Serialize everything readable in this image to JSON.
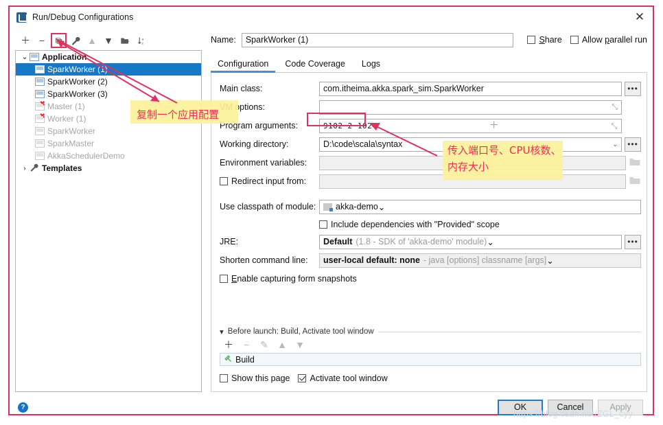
{
  "window": {
    "title": "Run/Debug Configurations",
    "close_label": "✕",
    "app_icon": "intellij-run-icon"
  },
  "left_toolbar": {
    "buttons": [
      {
        "name": "add-configuration",
        "glyph": "＋",
        "disabled": false,
        "highlighted": false
      },
      {
        "name": "remove-configuration",
        "glyph": "−",
        "disabled": false,
        "highlighted": false
      },
      {
        "name": "copy-configuration",
        "glyph": "⧉",
        "disabled": false,
        "highlighted": true
      },
      {
        "name": "edit-templates",
        "glyph": "🔧",
        "disabled": false,
        "highlighted": false
      },
      {
        "name": "move-up",
        "glyph": "▲",
        "disabled": true,
        "highlighted": false
      },
      {
        "name": "move-down",
        "glyph": "▼",
        "disabled": false,
        "highlighted": false
      },
      {
        "name": "move-into-folder",
        "glyph": "◧",
        "disabled": false,
        "highlighted": false
      },
      {
        "name": "sort-configurations",
        "glyph": "↓",
        "disabled": false,
        "highlighted": false
      }
    ]
  },
  "tree": {
    "groups": [
      {
        "label": "Application",
        "expanded": true,
        "twisty": "⌄",
        "icon": "application-folder-icon",
        "items": [
          {
            "label": "SparkWorker (1)",
            "selected": true,
            "faded": false,
            "error": false
          },
          {
            "label": "SparkWorker (2)",
            "selected": false,
            "faded": false,
            "error": false
          },
          {
            "label": "SparkWorker (3)",
            "selected": false,
            "faded": false,
            "error": false
          },
          {
            "label": "Master (1)",
            "selected": false,
            "faded": true,
            "error": true
          },
          {
            "label": "Worker (1)",
            "selected": false,
            "faded": true,
            "error": true
          },
          {
            "label": "SparkWorker",
            "selected": false,
            "faded": true,
            "error": false
          },
          {
            "label": "SparkMaster",
            "selected": false,
            "faded": true,
            "error": false
          },
          {
            "label": "AkkaSchedulerDemo",
            "selected": false,
            "faded": true,
            "error": false
          }
        ]
      },
      {
        "label": "Templates",
        "expanded": false,
        "twisty": "›",
        "icon": "wrench-icon",
        "items": []
      }
    ]
  },
  "header": {
    "name_label": "Name:",
    "name_value": "SparkWorker (1)",
    "share_label": "Share",
    "share_checked": false,
    "allow_parallel_label": "Allow parallel run",
    "allow_parallel_checked": false
  },
  "tabs": [
    {
      "label": "Configuration",
      "active": true
    },
    {
      "label": "Code Coverage",
      "active": false
    },
    {
      "label": "Logs",
      "active": false
    }
  ],
  "form": {
    "main_class": {
      "label": "Main class:",
      "value": "com.itheima.akka.spark_sim.SparkWorker",
      "browse_glyph": "•••"
    },
    "vm_options": {
      "label": "VM options:",
      "value": "",
      "expand_glyph": "⤡"
    },
    "program_arguments": {
      "label": "Program arguments:",
      "value": "9102 2 1024",
      "plus_glyph": "＋",
      "expand_glyph": "⤡"
    },
    "working_directory": {
      "label": "Working directory:",
      "value": "D:\\code\\scala\\syntax",
      "caret_glyph": "⌄",
      "browse_glyph": "•••"
    },
    "environment_variables": {
      "label": "Environment variables:",
      "value": "",
      "folder_glyph": "🗀"
    },
    "redirect_input": {
      "label": "Redirect input from:",
      "checked": false,
      "value": "",
      "folder_glyph": "🗀"
    },
    "classpath_module": {
      "label": "Use classpath of module:",
      "value": "akka-demo",
      "caret_glyph": "⌄"
    },
    "include_provided": {
      "label": "Include dependencies with \"Provided\" scope",
      "checked": false
    },
    "jre": {
      "label": "JRE:",
      "value": "Default",
      "hint": "(1.8 - SDK of 'akka-demo' module)",
      "caret_glyph": "⌄",
      "browse_glyph": "•••"
    },
    "shorten_command_line": {
      "label": "Shorten command line:",
      "value": "user-local default: none",
      "hint": "- java [options] classname [args]",
      "caret_glyph": "⌄"
    },
    "form_snapshots": {
      "label": "Enable capturing form snapshots",
      "checked": false
    }
  },
  "before_launch": {
    "header": "Before launch: Build, Activate tool window",
    "collapse_glyph": "▾",
    "tools": [
      {
        "name": "add-task",
        "glyph": "＋",
        "disabled": false
      },
      {
        "name": "remove-task",
        "glyph": "−",
        "disabled": true
      },
      {
        "name": "edit-task",
        "glyph": "✎",
        "disabled": true
      },
      {
        "name": "move-task-up",
        "glyph": "▲",
        "disabled": true
      },
      {
        "name": "move-task-down",
        "glyph": "▼",
        "disabled": true
      }
    ],
    "tasks": [
      {
        "label": "Build",
        "icon": "hammer-icon"
      }
    ],
    "show_this_page": {
      "label": "Show this page",
      "checked": false
    },
    "activate_tool_window": {
      "label": "Activate tool window",
      "checked": true
    }
  },
  "footer": {
    "help_glyph": "?",
    "ok_label": "OK",
    "cancel_label": "Cancel",
    "apply_label": "Apply"
  },
  "annotations": {
    "note_copy": "复制一个应用配置",
    "note_args_line1": "传入端口号、CPU核数、",
    "note_args_line2": "内存大小",
    "accent_color": "#e0315c",
    "highlight_color": "#fbf29a"
  },
  "watermark": "https://blog.csdn.net/ZGL_cyy"
}
